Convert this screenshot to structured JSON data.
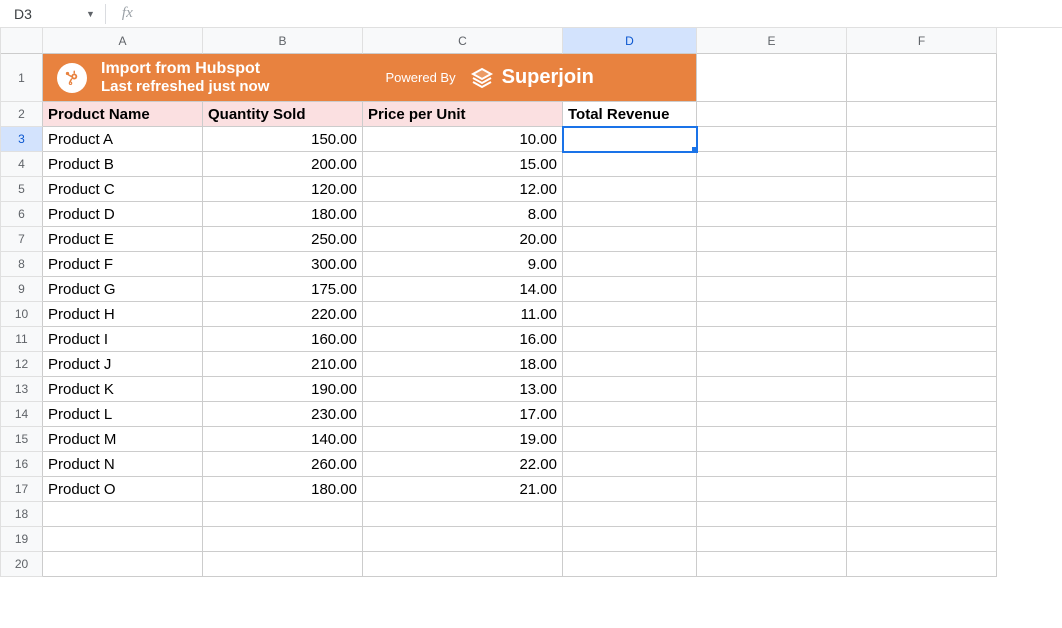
{
  "name_box": {
    "value": "D3",
    "fx_label": "fx",
    "formula": ""
  },
  "columns": [
    "A",
    "B",
    "C",
    "D",
    "E",
    "F"
  ],
  "active_column": "D",
  "active_row": 3,
  "row_numbers": [
    1,
    2,
    3,
    4,
    5,
    6,
    7,
    8,
    9,
    10,
    11,
    12,
    13,
    14,
    15,
    16,
    17,
    18,
    19,
    20
  ],
  "banner": {
    "title": "Import from Hubspot",
    "subtitle": "Last refreshed just now",
    "powered_by": "Powered By",
    "brand": "Superjoin"
  },
  "headers": {
    "a": "Product Name",
    "b": "Quantity Sold",
    "c": "Price per Unit",
    "d": "Total Revenue"
  },
  "rows": [
    {
      "name": "Product A",
      "qty": "150.00",
      "price": "10.00"
    },
    {
      "name": "Product B",
      "qty": "200.00",
      "price": "15.00"
    },
    {
      "name": "Product C",
      "qty": "120.00",
      "price": "12.00"
    },
    {
      "name": "Product D",
      "qty": "180.00",
      "price": "8.00"
    },
    {
      "name": "Product E",
      "qty": "250.00",
      "price": "20.00"
    },
    {
      "name": "Product F",
      "qty": "300.00",
      "price": "9.00"
    },
    {
      "name": "Product G",
      "qty": "175.00",
      "price": "14.00"
    },
    {
      "name": "Product H",
      "qty": "220.00",
      "price": "11.00"
    },
    {
      "name": "Product I",
      "qty": "160.00",
      "price": "16.00"
    },
    {
      "name": "Product J",
      "qty": "210.00",
      "price": "18.00"
    },
    {
      "name": "Product K",
      "qty": "190.00",
      "price": "13.00"
    },
    {
      "name": "Product L",
      "qty": "230.00",
      "price": "17.00"
    },
    {
      "name": "Product M",
      "qty": "140.00",
      "price": "19.00"
    },
    {
      "name": "Product N",
      "qty": "260.00",
      "price": "22.00"
    },
    {
      "name": "Product O",
      "qty": "180.00",
      "price": "21.00"
    }
  ]
}
